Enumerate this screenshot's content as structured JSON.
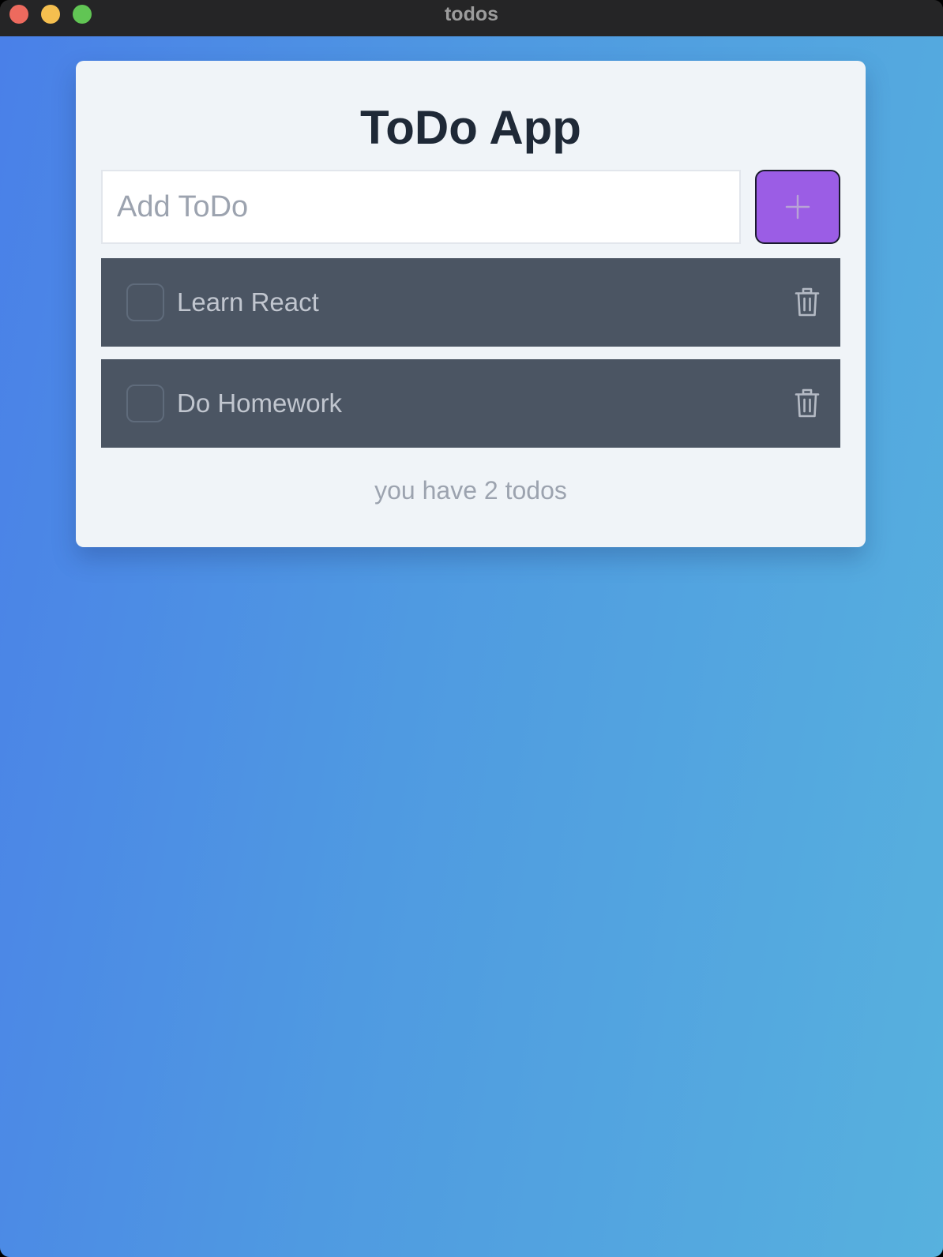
{
  "window": {
    "title": "todos",
    "traffic_lights": {
      "close_color": "#ED6A5E",
      "minimize_color": "#F5BF4F",
      "maximize_color": "#61C554"
    }
  },
  "app": {
    "title": "ToDo App",
    "input": {
      "placeholder": "Add ToDo",
      "value": ""
    },
    "add_button": {
      "icon": "plus-icon",
      "color": "#9b5de5"
    },
    "todos": [
      {
        "label": "Learn React",
        "completed": false,
        "delete_icon": "trash-icon"
      },
      {
        "label": "Do Homework",
        "completed": false,
        "delete_icon": "trash-icon"
      }
    ],
    "footer": {
      "count_text": "you have 2 todos"
    }
  },
  "colors": {
    "gradient_start": "#4a80e8",
    "gradient_end": "#57b1de",
    "card_background": "#f0f4f8",
    "todo_item_background": "#4b5563"
  }
}
